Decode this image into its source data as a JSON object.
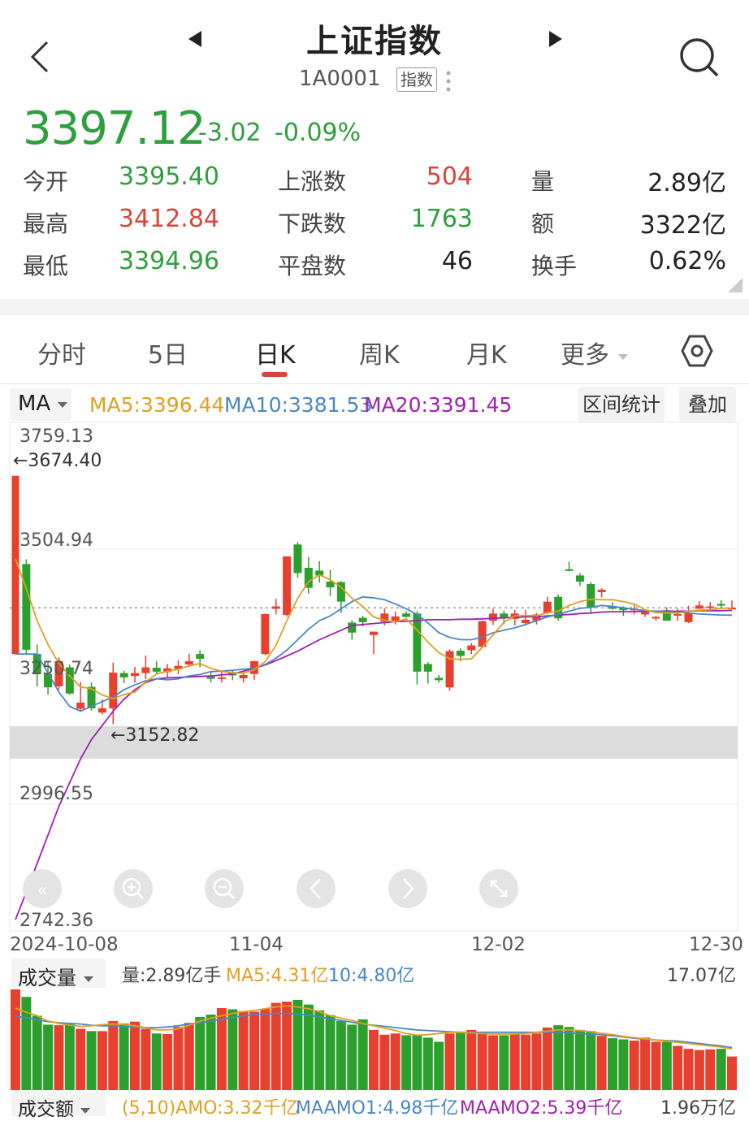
{
  "header": {
    "title": "上证指数",
    "code": "1A0001",
    "tag": "指数"
  },
  "quote": {
    "price": "3397.12",
    "change": "-3.02",
    "change_pct": "-0.09%"
  },
  "stats": [
    {
      "label": "今开",
      "value": "3395.40",
      "color": "green"
    },
    {
      "label": "最高",
      "value": "3412.84",
      "color": "red"
    },
    {
      "label": "最低",
      "value": "3394.96",
      "color": "green"
    },
    {
      "label": "上涨数",
      "value": "504",
      "color": "red"
    },
    {
      "label": "下跌数",
      "value": "1763",
      "color": "green"
    },
    {
      "label": "平盘数",
      "value": "46",
      "color": "dark"
    },
    {
      "label": "量",
      "value": "2.89亿",
      "color": "dark"
    },
    {
      "label": "额",
      "value": "3322亿",
      "color": "dark"
    },
    {
      "label": "换手",
      "value": "0.62%",
      "color": "dark"
    }
  ],
  "tabs": [
    "分时",
    "5日",
    "日K",
    "周K",
    "月K",
    "更多"
  ],
  "active_tab": "日K",
  "ma_bar": {
    "selector": "MA",
    "ma5": "MA5:3396.44",
    "ma10": "MA10:3381.53",
    "ma20": "MA20:3391.45",
    "range_stats": "区间统计",
    "overlay": "叠加"
  },
  "chart_labels": {
    "y_top": "3759.13",
    "y_mid1": "3504.94",
    "y_mid2": "3250.74",
    "y_low": "2996.55",
    "y_bottom": "2742.36",
    "max_marker": "←3674.40",
    "min_marker": "←3152.82",
    "x_ticks": [
      "2024-10-08",
      "11-04",
      "12-02",
      "12-30"
    ]
  },
  "volume_bar": {
    "selector": "成交量",
    "volume": "量:2.89亿手",
    "ma5": "MA5:4.31亿",
    "ma10": "10:4.80亿",
    "max": "17.07亿"
  },
  "amount_bar": {
    "selector": "成交额",
    "amo": "(5,10)AMO:3.32千亿",
    "maamo1": "MAAMO1:4.98千亿",
    "maamo2": "MAAMO2:5.39千亿",
    "max": "1.96万亿"
  },
  "colors": {
    "up": "#e8402f",
    "down": "#2ca02c",
    "ma5": "#e0a020",
    "ma10": "#4a86c8",
    "ma20": "#a020b0",
    "price_green": "#2e9e3e"
  },
  "chart_data": {
    "type": "candlestick",
    "ylim": [
      2742.36,
      3759.13
    ],
    "candles": [
      [
        3674.4,
        3674.4,
        3674.4,
        3674.4
      ],
      [
        3489,
        3499,
        3300,
        3309
      ],
      [
        3300,
        3320,
        3232,
        3258
      ],
      [
        3258,
        3285,
        3215,
        3230
      ],
      [
        3232,
        3293,
        3225,
        3285
      ],
      [
        3272,
        3278,
        3215,
        3217
      ],
      [
        3185,
        3241,
        3180,
        3198
      ],
      [
        3231,
        3240,
        3181,
        3186
      ],
      [
        3177,
        3205,
        3173,
        3186
      ],
      [
        3186,
        3282,
        3152.82,
        3261
      ],
      [
        3260,
        3265,
        3239,
        3251
      ],
      [
        3254,
        3273,
        3240,
        3260
      ],
      [
        3260,
        3297,
        3247,
        3272
      ],
      [
        3271,
        3285,
        3258,
        3263
      ],
      [
        3262,
        3279,
        3250,
        3270
      ],
      [
        3268,
        3287,
        3258,
        3275
      ],
      [
        3278,
        3301,
        3273,
        3285
      ],
      [
        3300,
        3308,
        3272,
        3290
      ],
      [
        3253,
        3263,
        3240,
        3248
      ],
      [
        3250,
        3265,
        3240,
        3251
      ],
      [
        3262,
        3266,
        3245,
        3255
      ],
      [
        3249,
        3261,
        3240,
        3256
      ],
      [
        3258,
        3286,
        3245,
        3285
      ],
      [
        3300,
        3385,
        3298,
        3384
      ],
      [
        3395,
        3416,
        3383,
        3400
      ],
      [
        3382,
        3505,
        3379,
        3505
      ],
      [
        3530,
        3535,
        3460,
        3470
      ],
      [
        3481,
        3504,
        3427,
        3439
      ],
      [
        3475,
        3495,
        3450,
        3465
      ],
      [
        3452,
        3477,
        3422,
        3440
      ],
      [
        3451,
        3453,
        3386,
        3410
      ],
      [
        3366,
        3371,
        3330,
        3345
      ],
      [
        3376,
        3380,
        3358,
        3367
      ],
      [
        3340,
        3347,
        3300,
        3347
      ],
      [
        3368,
        3396,
        3360,
        3385
      ],
      [
        3370,
        3389,
        3362,
        3379
      ],
      [
        3385,
        3390,
        3377,
        3378
      ],
      [
        3385,
        3390,
        3236,
        3263
      ],
      [
        3279,
        3283,
        3238,
        3263
      ],
      [
        3250,
        3256,
        3240,
        3245
      ],
      [
        3230,
        3310,
        3223,
        3306
      ],
      [
        3307,
        3312,
        3285,
        3296
      ],
      [
        3308,
        3323,
        3300,
        3318
      ],
      [
        3315,
        3370,
        3312,
        3369
      ],
      [
        3370,
        3395,
        3361,
        3385
      ],
      [
        3385,
        3391,
        3363,
        3377
      ],
      [
        3374,
        3393,
        3360,
        3385
      ],
      [
        3365,
        3393,
        3360,
        3372
      ],
      [
        3370,
        3386,
        3362,
        3383
      ],
      [
        3386,
        3420,
        3384,
        3410
      ],
      [
        3420,
        3425,
        3370,
        3375
      ],
      [
        3478,
        3494,
        3474,
        3476
      ],
      [
        3465,
        3470,
        3443,
        3452
      ],
      [
        3447,
        3451,
        3385,
        3397
      ],
      [
        3430,
        3438,
        3419,
        3435
      ],
      [
        3400,
        3409,
        3393,
        3395
      ],
      [
        3397,
        3400,
        3380,
        3392
      ],
      [
        3395,
        3403,
        3383,
        3395
      ],
      [
        3383,
        3393,
        3378,
        3390
      ],
      [
        3375,
        3380,
        3370,
        3378
      ],
      [
        3392,
        3398,
        3370,
        3370
      ],
      [
        3381,
        3395,
        3370,
        3384
      ],
      [
        3367,
        3401,
        3365,
        3386
      ],
      [
        3395,
        3411,
        3395,
        3402
      ],
      [
        3399,
        3409,
        3393,
        3400
      ],
      [
        3405,
        3413,
        3395,
        3403
      ],
      [
        3395.4,
        3412.84,
        3394.96,
        3397.12
      ]
    ],
    "ma5": [
      3500,
      3437,
      3370,
      3320,
      3280,
      3254,
      3231,
      3227,
      3214,
      3206,
      3215,
      3220,
      3241,
      3258,
      3264,
      3268,
      3275,
      3280,
      3270,
      3264,
      3260,
      3260,
      3267,
      3284,
      3318,
      3370,
      3417,
      3452,
      3466,
      3456,
      3440,
      3417,
      3400,
      3378,
      3371,
      3367,
      3374,
      3350,
      3325,
      3303,
      3290,
      3289,
      3290,
      3314,
      3340,
      3367,
      3380,
      3381,
      3380,
      3387,
      3390,
      3402,
      3410,
      3415,
      3414,
      3414,
      3410,
      3405,
      3393,
      3387,
      3386,
      3386,
      3390,
      3392,
      3393,
      3396,
      3396.44
    ],
    "ma10": [
      3300,
      3300,
      3300,
      3260,
      3220,
      3190,
      3180,
      3190,
      3200,
      3210,
      3225,
      3235,
      3244,
      3248,
      3246,
      3248,
      3254,
      3257,
      3263,
      3264,
      3266,
      3268,
      3270,
      3278,
      3291,
      3308,
      3330,
      3352,
      3370,
      3380,
      3395,
      3410,
      3420,
      3418,
      3414,
      3405,
      3395,
      3383,
      3365,
      3345,
      3335,
      3330,
      3330,
      3335,
      3345,
      3350,
      3355,
      3362,
      3370,
      3378,
      3383,
      3390,
      3396,
      3398,
      3402,
      3400,
      3397,
      3394,
      3391,
      3390,
      3389,
      3388,
      3386,
      3384,
      3383,
      3382,
      3381.53
    ],
    "ma20": [
      2742,
      2800,
      2860,
      2920,
      2980,
      3030,
      3080,
      3120,
      3150,
      3180,
      3205,
      3225,
      3240,
      3248,
      3250,
      3251,
      3252,
      3253,
      3254,
      3256,
      3258,
      3264,
      3270,
      3277,
      3286,
      3296,
      3306,
      3318,
      3330,
      3340,
      3350,
      3360,
      3362,
      3364,
      3366,
      3368,
      3369,
      3370,
      3372,
      3372,
      3372,
      3373,
      3373,
      3374,
      3375,
      3376,
      3377,
      3378,
      3378,
      3380,
      3382,
      3383,
      3385,
      3386,
      3388,
      3389,
      3389,
      3389,
      3390,
      3390,
      3390,
      3390,
      3390,
      3391,
      3391,
      3391,
      3391.45
    ],
    "volume": {
      "ylim": [
        0,
        17.07
      ],
      "values": [
        17.07,
        15.8,
        12.6,
        11.1,
        11.0,
        11.2,
        10.4,
        10.0,
        10.0,
        11.7,
        11.3,
        11.6,
        10.4,
        9.6,
        9.5,
        10.7,
        11.4,
        12.4,
        12.8,
        13.9,
        13.7,
        13.4,
        13.3,
        13.8,
        14.8,
        15.0,
        15.3,
        14.5,
        13.5,
        12.7,
        11.7,
        11.1,
        12.0,
        10.2,
        9.4,
        9.6,
        9.3,
        9.3,
        8.9,
        8.2,
        9.6,
        9.9,
        10.2,
        9.6,
        9.3,
        9.3,
        9.6,
        9.4,
        9.6,
        10.6,
        11.0,
        10.7,
        10.2,
        10.0,
        9.2,
        8.8,
        8.6,
        8.4,
        8.9,
        8.2,
        8.2,
        7.5,
        7.0,
        6.8,
        6.9,
        7.0,
        5.7
      ],
      "ma5": [
        13.9,
        13.2,
        12.6,
        11.7,
        11.3,
        11.0,
        10.8,
        10.9,
        11.1,
        11.2,
        11.1,
        10.9,
        10.6,
        10.2,
        10.2,
        10.4,
        11.0,
        11.7,
        12.2,
        12.6,
        13.0,
        13.3,
        13.5,
        13.8,
        14.1,
        14.3,
        14.1,
        13.8,
        13.3,
        12.6,
        12.2,
        11.8,
        11.3,
        10.9,
        10.5,
        10.1,
        9.6,
        9.3,
        9.4,
        9.6,
        9.8,
        9.8,
        9.7,
        9.6,
        9.5,
        9.5,
        9.5,
        9.6,
        9.8,
        10.0,
        10.2,
        10.2,
        10.1,
        9.9,
        9.6,
        9.4,
        9.1,
        8.9,
        8.7,
        8.5,
        8.3,
        8.1,
        7.9,
        7.7,
        7.5,
        7.3,
        7.0
      ],
      "ma10": [
        12.5,
        12.3,
        11.9,
        11.6,
        11.4,
        11.3,
        11.2,
        11.0,
        10.9,
        10.9,
        10.8,
        10.7,
        10.6,
        10.6,
        10.7,
        10.9,
        11.2,
        11.4,
        11.7,
        12.0,
        12.3,
        12.6,
        12.8,
        12.9,
        13.0,
        13.0,
        12.9,
        12.7,
        12.4,
        12.1,
        11.8,
        11.5,
        11.2,
        11.0,
        10.8,
        10.6,
        10.4,
        10.2,
        10.1,
        10.0,
        9.9,
        9.8,
        9.8,
        9.8,
        9.8,
        9.8,
        9.8,
        9.8,
        9.8,
        9.8,
        9.8,
        9.7,
        9.6,
        9.5,
        9.4,
        9.2,
        9.0,
        8.8,
        8.6,
        8.5,
        8.4,
        8.3,
        8.1,
        7.9,
        7.7,
        7.5,
        7.2
      ]
    }
  }
}
